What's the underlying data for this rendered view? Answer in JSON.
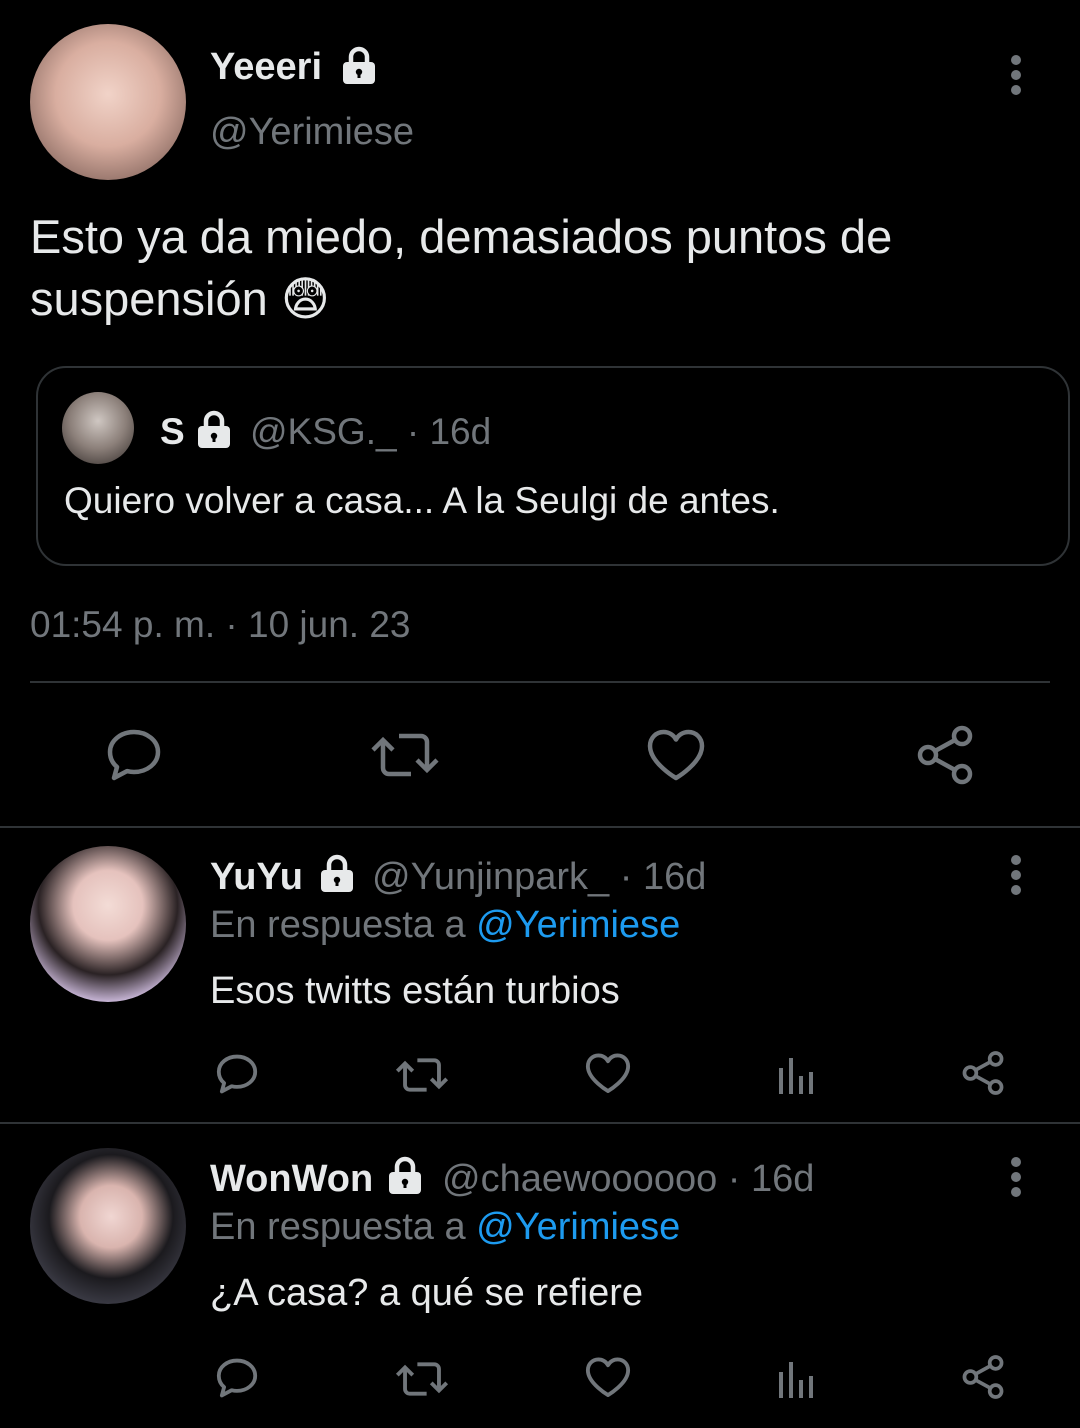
{
  "main_tweet": {
    "author_name": "Yeeeri",
    "author_handle": "@Yerimiese",
    "text": "Esto ya da miedo, demasiados puntos de suspensión",
    "emoji": "😨",
    "timestamp": "01:54 p. m. · 10 jun. 23",
    "quoted": {
      "author_name": "S",
      "author_handle": "@KSG._",
      "age": "· 16d",
      "text": "Quiero volver a casa... A la Seulgi de antes."
    }
  },
  "replies": [
    {
      "author_name": "YuYu",
      "author_handle": "@Yunjinpark_",
      "age": "· 16d",
      "reply_prefix": "En respuesta a",
      "reply_to": "@Yerimiese",
      "text": "Esos twitts están turbios"
    },
    {
      "author_name": "WonWon",
      "author_handle": "@chaewoooooo",
      "age": "· 16d",
      "reply_prefix": "En respuesta a",
      "reply_to": "@Yerimiese",
      "text": "¿A casa? a qué se refiere"
    }
  ],
  "icons": {
    "lock": "lock-icon",
    "more": "more-vertical-icon",
    "reply": "reply-icon",
    "retweet": "retweet-icon",
    "like": "heart-icon",
    "share": "share-icon",
    "views": "views-icon"
  },
  "colors": {
    "background": "#000000",
    "text": "#e7e9ea",
    "secondary": "#71767b",
    "accent": "#1d9bf0",
    "border": "#2f3336"
  }
}
